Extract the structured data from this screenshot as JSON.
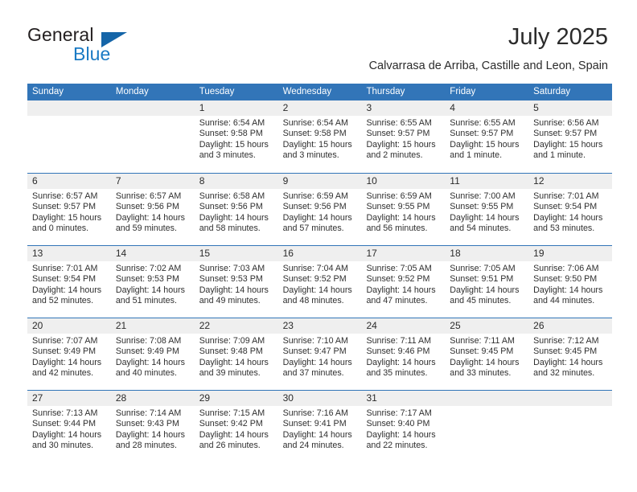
{
  "logo": {
    "word1": "General",
    "word2": "Blue",
    "flag_icon": "triangle-flag-icon",
    "color_dark": "#231f20",
    "color_blue": "#1a7ac4",
    "flag_color": "#1565a8"
  },
  "header": {
    "title": "July 2025",
    "location": "Calvarrasa de Arriba, Castille and Leon, Spain",
    "accent_color": "#3275b8",
    "band_color": "#efefef"
  },
  "weekday_headers": [
    "Sunday",
    "Monday",
    "Tuesday",
    "Wednesday",
    "Thursday",
    "Friday",
    "Saturday"
  ],
  "weeks": [
    [
      {
        "day": "",
        "blank": true,
        "sunrise": "",
        "sunset": "",
        "daylight_l1": "",
        "daylight_l2": ""
      },
      {
        "day": "",
        "blank": true,
        "sunrise": "",
        "sunset": "",
        "daylight_l1": "",
        "daylight_l2": ""
      },
      {
        "day": "1",
        "sunrise": "Sunrise: 6:54 AM",
        "sunset": "Sunset: 9:58 PM",
        "daylight_l1": "Daylight: 15 hours",
        "daylight_l2": "and 3 minutes."
      },
      {
        "day": "2",
        "sunrise": "Sunrise: 6:54 AM",
        "sunset": "Sunset: 9:58 PM",
        "daylight_l1": "Daylight: 15 hours",
        "daylight_l2": "and 3 minutes."
      },
      {
        "day": "3",
        "sunrise": "Sunrise: 6:55 AM",
        "sunset": "Sunset: 9:57 PM",
        "daylight_l1": "Daylight: 15 hours",
        "daylight_l2": "and 2 minutes."
      },
      {
        "day": "4",
        "sunrise": "Sunrise: 6:55 AM",
        "sunset": "Sunset: 9:57 PM",
        "daylight_l1": "Daylight: 15 hours",
        "daylight_l2": "and 1 minute."
      },
      {
        "day": "5",
        "sunrise": "Sunrise: 6:56 AM",
        "sunset": "Sunset: 9:57 PM",
        "daylight_l1": "Daylight: 15 hours",
        "daylight_l2": "and 1 minute."
      }
    ],
    [
      {
        "day": "6",
        "sunrise": "Sunrise: 6:57 AM",
        "sunset": "Sunset: 9:57 PM",
        "daylight_l1": "Daylight: 15 hours",
        "daylight_l2": "and 0 minutes."
      },
      {
        "day": "7",
        "sunrise": "Sunrise: 6:57 AM",
        "sunset": "Sunset: 9:56 PM",
        "daylight_l1": "Daylight: 14 hours",
        "daylight_l2": "and 59 minutes."
      },
      {
        "day": "8",
        "sunrise": "Sunrise: 6:58 AM",
        "sunset": "Sunset: 9:56 PM",
        "daylight_l1": "Daylight: 14 hours",
        "daylight_l2": "and 58 minutes."
      },
      {
        "day": "9",
        "sunrise": "Sunrise: 6:59 AM",
        "sunset": "Sunset: 9:56 PM",
        "daylight_l1": "Daylight: 14 hours",
        "daylight_l2": "and 57 minutes."
      },
      {
        "day": "10",
        "sunrise": "Sunrise: 6:59 AM",
        "sunset": "Sunset: 9:55 PM",
        "daylight_l1": "Daylight: 14 hours",
        "daylight_l2": "and 56 minutes."
      },
      {
        "day": "11",
        "sunrise": "Sunrise: 7:00 AM",
        "sunset": "Sunset: 9:55 PM",
        "daylight_l1": "Daylight: 14 hours",
        "daylight_l2": "and 54 minutes."
      },
      {
        "day": "12",
        "sunrise": "Sunrise: 7:01 AM",
        "sunset": "Sunset: 9:54 PM",
        "daylight_l1": "Daylight: 14 hours",
        "daylight_l2": "and 53 minutes."
      }
    ],
    [
      {
        "day": "13",
        "sunrise": "Sunrise: 7:01 AM",
        "sunset": "Sunset: 9:54 PM",
        "daylight_l1": "Daylight: 14 hours",
        "daylight_l2": "and 52 minutes."
      },
      {
        "day": "14",
        "sunrise": "Sunrise: 7:02 AM",
        "sunset": "Sunset: 9:53 PM",
        "daylight_l1": "Daylight: 14 hours",
        "daylight_l2": "and 51 minutes."
      },
      {
        "day": "15",
        "sunrise": "Sunrise: 7:03 AM",
        "sunset": "Sunset: 9:53 PM",
        "daylight_l1": "Daylight: 14 hours",
        "daylight_l2": "and 49 minutes."
      },
      {
        "day": "16",
        "sunrise": "Sunrise: 7:04 AM",
        "sunset": "Sunset: 9:52 PM",
        "daylight_l1": "Daylight: 14 hours",
        "daylight_l2": "and 48 minutes."
      },
      {
        "day": "17",
        "sunrise": "Sunrise: 7:05 AM",
        "sunset": "Sunset: 9:52 PM",
        "daylight_l1": "Daylight: 14 hours",
        "daylight_l2": "and 47 minutes."
      },
      {
        "day": "18",
        "sunrise": "Sunrise: 7:05 AM",
        "sunset": "Sunset: 9:51 PM",
        "daylight_l1": "Daylight: 14 hours",
        "daylight_l2": "and 45 minutes."
      },
      {
        "day": "19",
        "sunrise": "Sunrise: 7:06 AM",
        "sunset": "Sunset: 9:50 PM",
        "daylight_l1": "Daylight: 14 hours",
        "daylight_l2": "and 44 minutes."
      }
    ],
    [
      {
        "day": "20",
        "sunrise": "Sunrise: 7:07 AM",
        "sunset": "Sunset: 9:49 PM",
        "daylight_l1": "Daylight: 14 hours",
        "daylight_l2": "and 42 minutes."
      },
      {
        "day": "21",
        "sunrise": "Sunrise: 7:08 AM",
        "sunset": "Sunset: 9:49 PM",
        "daylight_l1": "Daylight: 14 hours",
        "daylight_l2": "and 40 minutes."
      },
      {
        "day": "22",
        "sunrise": "Sunrise: 7:09 AM",
        "sunset": "Sunset: 9:48 PM",
        "daylight_l1": "Daylight: 14 hours",
        "daylight_l2": "and 39 minutes."
      },
      {
        "day": "23",
        "sunrise": "Sunrise: 7:10 AM",
        "sunset": "Sunset: 9:47 PM",
        "daylight_l1": "Daylight: 14 hours",
        "daylight_l2": "and 37 minutes."
      },
      {
        "day": "24",
        "sunrise": "Sunrise: 7:11 AM",
        "sunset": "Sunset: 9:46 PM",
        "daylight_l1": "Daylight: 14 hours",
        "daylight_l2": "and 35 minutes."
      },
      {
        "day": "25",
        "sunrise": "Sunrise: 7:11 AM",
        "sunset": "Sunset: 9:45 PM",
        "daylight_l1": "Daylight: 14 hours",
        "daylight_l2": "and 33 minutes."
      },
      {
        "day": "26",
        "sunrise": "Sunrise: 7:12 AM",
        "sunset": "Sunset: 9:45 PM",
        "daylight_l1": "Daylight: 14 hours",
        "daylight_l2": "and 32 minutes."
      }
    ],
    [
      {
        "day": "27",
        "sunrise": "Sunrise: 7:13 AM",
        "sunset": "Sunset: 9:44 PM",
        "daylight_l1": "Daylight: 14 hours",
        "daylight_l2": "and 30 minutes."
      },
      {
        "day": "28",
        "sunrise": "Sunrise: 7:14 AM",
        "sunset": "Sunset: 9:43 PM",
        "daylight_l1": "Daylight: 14 hours",
        "daylight_l2": "and 28 minutes."
      },
      {
        "day": "29",
        "sunrise": "Sunrise: 7:15 AM",
        "sunset": "Sunset: 9:42 PM",
        "daylight_l1": "Daylight: 14 hours",
        "daylight_l2": "and 26 minutes."
      },
      {
        "day": "30",
        "sunrise": "Sunrise: 7:16 AM",
        "sunset": "Sunset: 9:41 PM",
        "daylight_l1": "Daylight: 14 hours",
        "daylight_l2": "and 24 minutes."
      },
      {
        "day": "31",
        "sunrise": "Sunrise: 7:17 AM",
        "sunset": "Sunset: 9:40 PM",
        "daylight_l1": "Daylight: 14 hours",
        "daylight_l2": "and 22 minutes."
      },
      {
        "day": "",
        "blank": true,
        "sunrise": "",
        "sunset": "",
        "daylight_l1": "",
        "daylight_l2": ""
      },
      {
        "day": "",
        "blank": true,
        "sunrise": "",
        "sunset": "",
        "daylight_l1": "",
        "daylight_l2": ""
      }
    ]
  ]
}
